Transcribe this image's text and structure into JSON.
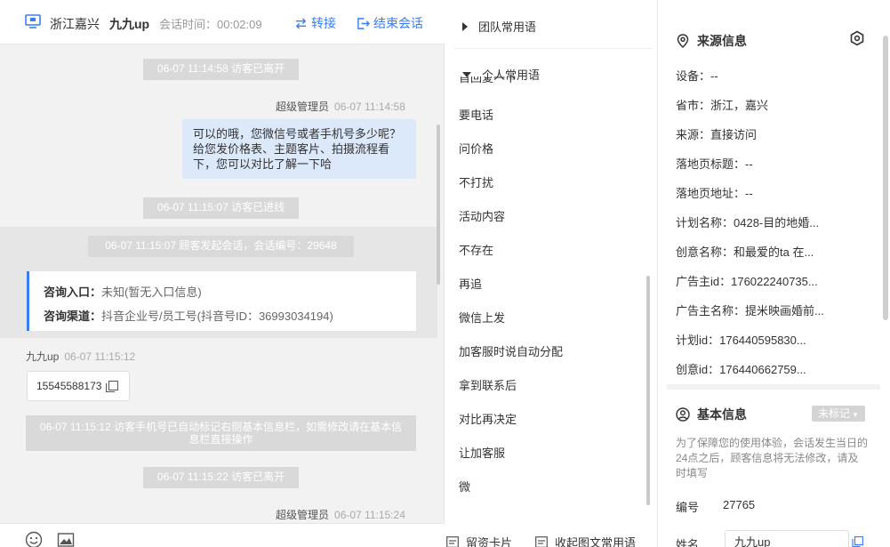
{
  "header": {
    "location": "浙江嘉兴",
    "visitor_name": "九九up",
    "session_time_label": "会话时间：00:02:09",
    "transfer_label": "转接",
    "end_label": "结束会话"
  },
  "messages": {
    "sys1": "06-07 11:14:58 访客已离开",
    "agent_meta_1_name": "超级管理员",
    "agent_meta_1_time": "06-07 11:14:58",
    "agent_bubble_1": "可以的哦，您微信号或者手机号多少呢？给您发价格表、主题客片、拍摄流程看下，您可以对比了解一下哈",
    "sys2": "06-07 11:15:07 访客已进线",
    "sys3": "06-07 11:15:07 顾客发起会话，会话编号：29648",
    "card_entry_label": "咨询入口：",
    "card_entry_value": "未知(暂无入口信息)",
    "card_channel_label": "咨询渠道：",
    "card_channel_value": "抖音企业号/员工号(抖音号ID：36993034194)",
    "visitor_meta_name": "九九up",
    "visitor_meta_time": "06-07 11:15:12",
    "visitor_phone": "15545588173",
    "sys4": "06-07 11:15:12 访客手机号已自动标记右侧基本信息栏，如需修改请在基本信息栏直接操作",
    "sys5": "06-07 11:15:22 访客已离开",
    "agent_meta_2_name": "超级管理员",
    "agent_meta_2_time": "06-07 11:15:24"
  },
  "quick_replies": {
    "team_label": "团队常用语",
    "personal_label": "个人常用语",
    "partial_item": "首回复一下",
    "items": [
      "要电话",
      "问价格",
      "不打扰",
      "活动内容",
      "不存在",
      "再追",
      "微信上发",
      "加客服时说自动分配",
      "拿到联系后",
      "对比再决定",
      "让加客服",
      "微"
    ],
    "footer_card": "留资卡片",
    "footer_collect": "收起图文常用语"
  },
  "source_info": {
    "title": "来源信息",
    "rows": [
      "设备：--",
      "省市：浙江，嘉兴",
      "来源：直接访问",
      "落地页标题：--",
      "落地页地址：--",
      "计划名称：0428-目的地婚...",
      "创意名称：和最爱的ta 在...",
      "广告主id：176022240735...",
      "广告主名称：提米映画婚前...",
      "计划id：176440595830...",
      "创意id：176440662759..."
    ]
  },
  "basic_info": {
    "title": "基本信息",
    "tag": "未标记",
    "note": "为了保障您的使用体验，会话发生当日的24点之后，顾客信息将无法修改，请及时填写",
    "id_label": "编号",
    "id_value": "27765",
    "name_label": "姓名",
    "name_value": "九九up"
  },
  "colors": {
    "accent": "#3a7cf5",
    "bubble": "#dce9fb",
    "system": "#d9d9d9"
  }
}
